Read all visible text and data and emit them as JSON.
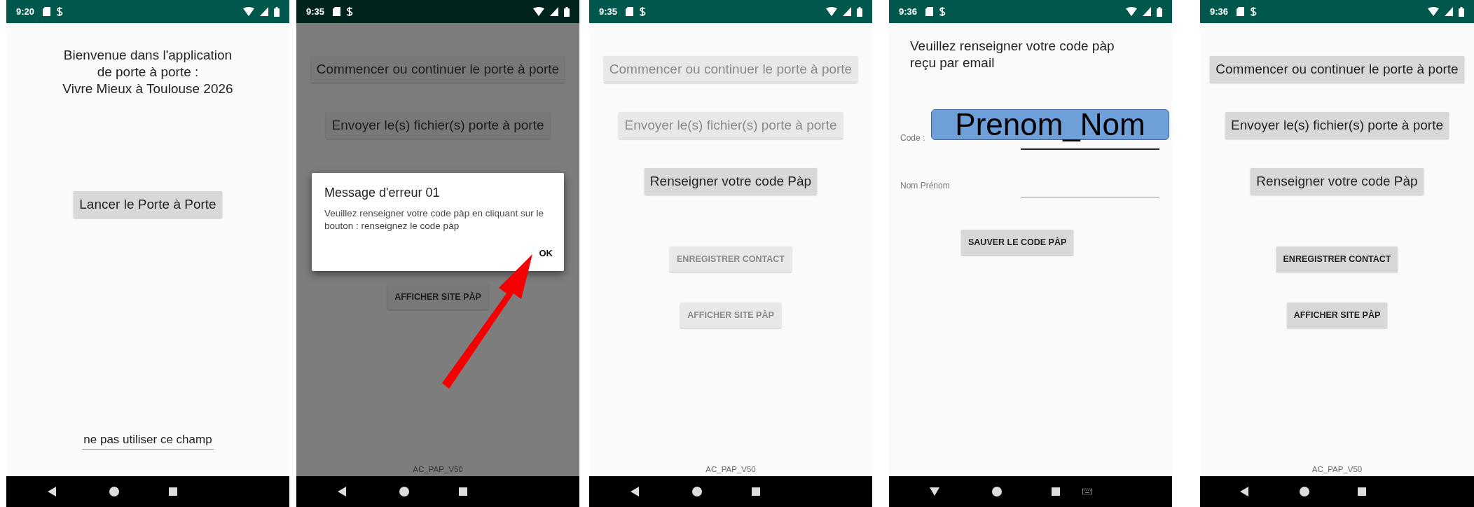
{
  "phones": [
    {
      "time": "9:20",
      "kind": "welcome",
      "dimmed": false,
      "keyboard_open": false,
      "items": [
        {
          "kind": "heading",
          "lines": [
            "Bienvenue dans l'application",
            "de porte à porte :",
            "Vivre Mieux à Toulouse 2026"
          ]
        },
        {
          "kind": "large_button",
          "label": "Lancer le Porte à Porte",
          "enabled": true
        },
        {
          "kind": "field",
          "value": "ne pas utiliser ce champ",
          "focused": false
        }
      ]
    },
    {
      "time": "9:35",
      "kind": "menu",
      "dimmed": true,
      "keyboard_open": false,
      "items": [
        {
          "kind": "large_button",
          "label": "Commencer ou continuer le porte à porte",
          "enabled": false
        },
        {
          "kind": "large_button",
          "label": "Envoyer le(s) fichier(s) porte à porte",
          "enabled": false
        },
        {
          "kind": "dialog",
          "title": "Message d'erreur 01",
          "message": "Veuillez renseigner votre code pàp en cliquant sur le bouton : renseignez le code pàp",
          "button": "OK",
          "pointer_arrow": true
        },
        {
          "kind": "small_button",
          "label": "AFFICHER SITE PÀP",
          "enabled": false
        },
        {
          "kind": "footer",
          "text": "AC_PAP_V50"
        }
      ]
    },
    {
      "time": "9:35",
      "kind": "menu",
      "dimmed": false,
      "keyboard_open": false,
      "items": [
        {
          "kind": "large_button",
          "label": "Commencer ou continuer le porte à porte",
          "enabled": false
        },
        {
          "kind": "large_button",
          "label": "Envoyer le(s) fichier(s) porte à porte",
          "enabled": false
        },
        {
          "kind": "large_button",
          "label": "Renseigner votre code Pàp",
          "enabled": true
        },
        {
          "kind": "small_button",
          "label": "ENREGISTRER CONTACT",
          "enabled": false
        },
        {
          "kind": "small_button",
          "label": "AFFICHER SITE PÀP",
          "enabled": false
        },
        {
          "kind": "footer",
          "text": "AC_PAP_V50"
        }
      ]
    },
    {
      "time": "9:36",
      "kind": "code_form",
      "dimmed": false,
      "keyboard_open": true,
      "items": [
        {
          "kind": "heading",
          "lines": [
            "Veuillez renseigner votre code pàp",
            "reçu par email"
          ]
        },
        {
          "kind": "field",
          "label": "Code :",
          "focused": true,
          "annotation": "Prenom_Nom"
        },
        {
          "kind": "field",
          "label": "Nom Prénom",
          "focused": false
        },
        {
          "kind": "small_button",
          "label": "SAUVER LE CODE PÀP",
          "enabled": true
        }
      ]
    },
    {
      "time": "9:36",
      "kind": "menu",
      "dimmed": false,
      "keyboard_open": false,
      "items": [
        {
          "kind": "large_button",
          "label": "Commencer ou continuer le porte à porte",
          "enabled": true
        },
        {
          "kind": "large_button",
          "label": "Envoyer le(s) fichier(s) porte à porte",
          "enabled": true
        },
        {
          "kind": "large_button",
          "label": "Renseigner votre code Pàp",
          "enabled": true
        },
        {
          "kind": "small_button",
          "label": "ENREGISTRER CONTACT",
          "enabled": true
        },
        {
          "kind": "small_button",
          "label": "AFFICHER SITE PÀP",
          "enabled": true
        },
        {
          "kind": "footer",
          "text": "AC_PAP_V50"
        }
      ]
    }
  ]
}
